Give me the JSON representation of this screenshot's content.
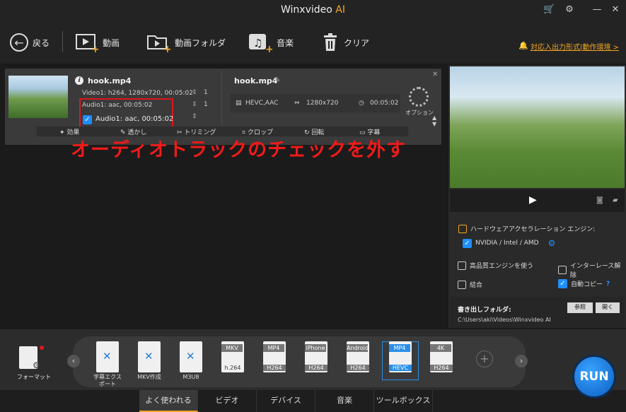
{
  "window": {
    "app_name": "Winxvideo",
    "app_suffix": "AI"
  },
  "toolbar": {
    "back": "戻る",
    "video": "動画",
    "video_folder": "動画フォルダ",
    "music": "音楽",
    "clear": "クリア",
    "link": "対応入出力形式|動作環境 >"
  },
  "file": {
    "name": "hook.mp4",
    "video_line": "Video1: h264, 1280x720, 00:05:02",
    "audio_line_top": "Audio1: aac, 00:05:02",
    "audio_line_checked": "Audio1: aac, 00:05:02",
    "stream_num": "1",
    "out_name": "hook.mp4",
    "out_codec": "HEVC,AAC",
    "out_res": "1280x720",
    "out_dur": "00:05:02",
    "option": "オプション"
  },
  "editbar": {
    "effect": "効果",
    "watermark": "透かし",
    "trim": "トリミング",
    "crop": "クロップ",
    "rotate": "回転",
    "subtitle": "字幕"
  },
  "annotation": "オーディオトラックのチェックを外す",
  "right": {
    "hw_label": "ハードウェアアクセラレーション エンジン:",
    "hw_option": "NVIDIA / Intel / AMD",
    "hq_engine": "高品質エンジンを使う",
    "deinterlace": "インターレース解除",
    "merge": "結合",
    "autocopy": "自動コピー",
    "folder_label": "書き出しフォルダ:",
    "browse": "参照",
    "open": "開く",
    "folder_path": "C:\\Users\\aki\\Videos\\Winxvideo AI"
  },
  "format_label": "フォーマット",
  "formats": [
    {
      "label": "字幕エクス\nポート",
      "tag": "",
      "codec": ""
    },
    {
      "label": "MKV作成",
      "tag": "",
      "codec": ""
    },
    {
      "label": "M3U8",
      "tag": "",
      "codec": ""
    },
    {
      "label": "",
      "tag": "MKV",
      "codec": "h.264"
    },
    {
      "label": "",
      "tag": "MP4",
      "codec": "H264"
    },
    {
      "label": "",
      "tag": "iPhone",
      "codec": "H264"
    },
    {
      "label": "",
      "tag": "Android",
      "codec": "H264"
    },
    {
      "label": "",
      "tag": "MP4",
      "codec": "HEVC"
    },
    {
      "label": "",
      "tag": "4K",
      "codec": "H264"
    }
  ],
  "tabs": [
    "よく使われる",
    "ビデオ",
    "デバイス",
    "音楽",
    "ツールボックス"
  ],
  "run": "RUN",
  "colors": {
    "accent": "#f5a623",
    "annotation_red": "#ef1a1a",
    "check_blue": "#1f8fff"
  }
}
